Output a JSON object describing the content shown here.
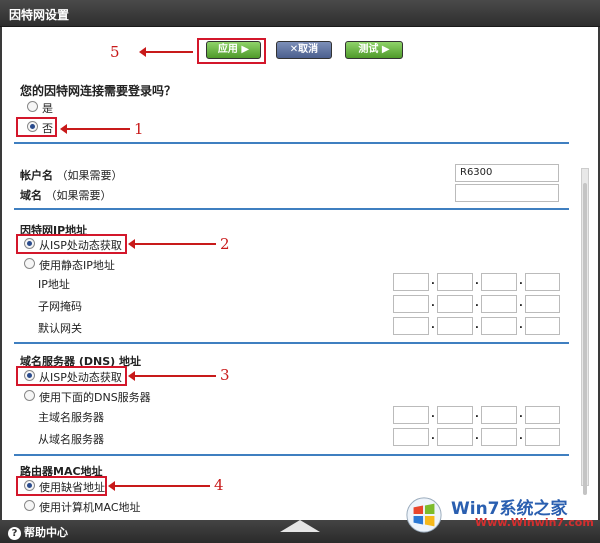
{
  "window": {
    "title": "因特网设置"
  },
  "toolbar": {
    "apply_label": "应用 ▶",
    "cancel_label": "✕取消",
    "test_label": "测试 ▶"
  },
  "login": {
    "question": "您的因特网连接需要登录吗？",
    "options": [
      "是",
      "否"
    ],
    "selected": "否"
  },
  "account": {
    "name_label": "帐户名",
    "name_hint": "（如果需要）",
    "name_value": "R6300",
    "domain_label": "域名",
    "domain_hint": "（如果需要）",
    "domain_value": ""
  },
  "ip_section": {
    "title": "因特网IP地址",
    "option_dynamic": "从ISP处动态获取",
    "option_static": "使用静态IP地址",
    "fields": [
      "IP地址",
      "子网掩码",
      "默认网关"
    ]
  },
  "dns_section": {
    "title": "域名服务器 (DNS) 地址",
    "option_dynamic": "从ISP处动态获取",
    "option_static": "使用下面的DNS服务器",
    "fields": [
      "主域名服务器",
      "从域名服务器"
    ]
  },
  "mac_section": {
    "title": "路由器MAC地址",
    "option_default": "使用缺省地址",
    "option_computer": "使用计算机MAC地址"
  },
  "annotations": [
    "5",
    "1",
    "2",
    "3",
    "4"
  ],
  "footer": {
    "help_label": "帮助中心"
  },
  "watermark": {
    "brand": "Win7系统之家",
    "url": "Www.Winwin7.com"
  },
  "colors": {
    "accent_line": "#3f7fc0",
    "annotation": "#c81a1a",
    "apply_green": "#4f9a2a",
    "cancel_blue": "#4b5f8e"
  }
}
